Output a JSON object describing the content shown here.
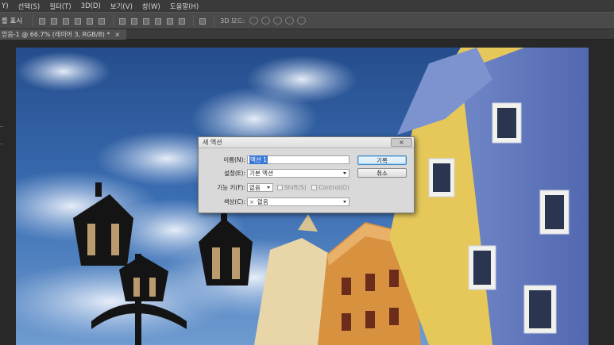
{
  "menu": [
    "Y)",
    "선택(S)",
    "필터(T)",
    "3D(D)",
    "보기(V)",
    "창(W)",
    "도움말(H)"
  ],
  "options": {
    "show_label": "를 표시",
    "mode3d_label": "3D 모드:"
  },
  "document_tab": {
    "title": "얻음-1 @ 66.7% (레이어 3, RGB/8) *",
    "close": "×"
  },
  "dialog": {
    "title": "새 액션",
    "close": "×",
    "name_label": "이름(N):",
    "name_value": "액션 1",
    "set_label": "설정(E):",
    "set_value": "기본 액션",
    "function_key_label": "기능 키(F):",
    "function_key_value": "없음",
    "shift_label": "Shift(S)",
    "control_label": "Control(O)",
    "color_label": "색상(C):",
    "color_mark": "×",
    "color_value": "없음",
    "record_button": "기록",
    "cancel_button": "취소"
  },
  "colors": {
    "accent_selection": "#3a78d6",
    "primary_button_border": "#3f87c6"
  }
}
